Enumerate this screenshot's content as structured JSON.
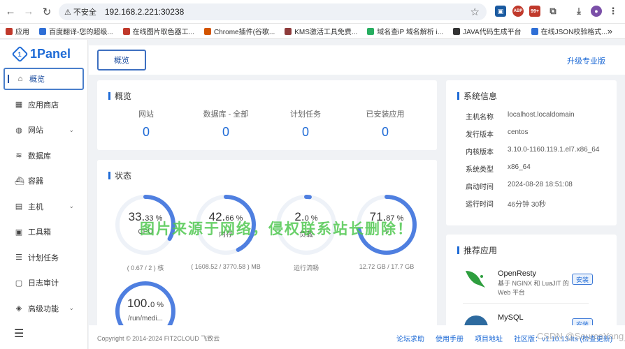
{
  "browser": {
    "url": "192.168.2.221:30238",
    "security_label": "不安全",
    "bookmarks": [
      {
        "label": "应用",
        "color": "#c0392b"
      },
      {
        "label": "百度翻译-您的超级...",
        "color": "#2f6fd6"
      },
      {
        "label": "在线图片取色器工...",
        "color": "#c0392b"
      },
      {
        "label": "Chrome插件(谷歌...",
        "color": "#d35400"
      },
      {
        "label": "KMS激活工具免费...",
        "color": "#8e3b3b"
      },
      {
        "label": "域名查iP 域名解析 i...",
        "color": "#27ae60"
      },
      {
        "label": "JAVA代码生成平台",
        "color": "#333333"
      },
      {
        "label": "在线JSON校验格式...",
        "color": "#2f6fd6"
      }
    ],
    "ext_badges": {
      "abp": "ABP",
      "count": "99+"
    }
  },
  "sidebar": {
    "brand": "1Panel",
    "items": [
      {
        "label": "概览",
        "icon": "home-icon",
        "glyph": "⌂",
        "active": true,
        "chevron": false
      },
      {
        "label": "应用商店",
        "icon": "grid-icon",
        "glyph": "▦",
        "chevron": false
      },
      {
        "label": "网站",
        "icon": "globe-icon",
        "glyph": "◍",
        "chevron": true
      },
      {
        "label": "数据库",
        "icon": "layers-icon",
        "glyph": "≋",
        "chevron": false
      },
      {
        "label": "容器",
        "icon": "docker-icon",
        "glyph": "⛴",
        "chevron": false
      },
      {
        "label": "主机",
        "icon": "host-icon",
        "glyph": "▤",
        "chevron": true
      },
      {
        "label": "工具箱",
        "icon": "toolbox-icon",
        "glyph": "▣",
        "chevron": false
      },
      {
        "label": "计划任务",
        "icon": "task-icon",
        "glyph": "☰",
        "chevron": false
      },
      {
        "label": "日志审计",
        "icon": "log-icon",
        "glyph": "▢",
        "chevron": false
      },
      {
        "label": "高级功能",
        "icon": "diamond-icon",
        "glyph": "◈",
        "chevron": true
      }
    ]
  },
  "header": {
    "tab": "概览",
    "upgrade": "升级专业版"
  },
  "overview": {
    "title": "概览",
    "stats": [
      {
        "label": "网站",
        "value": "0"
      },
      {
        "label": "数据库 - 全部",
        "value": "0"
      },
      {
        "label": "计划任务",
        "value": "0"
      },
      {
        "label": "已安装应用",
        "value": "0"
      }
    ]
  },
  "status": {
    "title": "状态",
    "gauges": [
      {
        "int": "33.",
        "dec": "33",
        "unit": " %",
        "label": "CPU",
        "percent": 33.33,
        "sub": "( 0.67 / 2 ) 核"
      },
      {
        "int": "42.",
        "dec": "66",
        "unit": " %",
        "label": "内存",
        "percent": 42.66,
        "sub": "( 1608.52 / 3770.58 ) MB"
      },
      {
        "int": "2.",
        "dec": "0",
        "unit": " %",
        "label": "负载",
        "percent": 2.0,
        "sub": "运行流畅"
      },
      {
        "int": "71.",
        "dec": "87",
        "unit": " %",
        "label": "/",
        "percent": 71.87,
        "sub": "12.72 GB / 17.7 GB"
      },
      {
        "int": "100.",
        "dec": "0",
        "unit": " %",
        "label": "/run/medi...",
        "percent": 100.0,
        "sub": ""
      }
    ]
  },
  "sysinfo": {
    "title": "系统信息",
    "rows": [
      {
        "k": "主机名称",
        "v": "localhost.localdomain"
      },
      {
        "k": "发行版本",
        "v": "centos"
      },
      {
        "k": "内核版本",
        "v": "3.10.0-1160.119.1.el7.x86_64"
      },
      {
        "k": "系统类型",
        "v": "x86_64"
      },
      {
        "k": "启动时间",
        "v": "2024-08-28 18:51:08"
      },
      {
        "k": "运行时间",
        "v": "46分钟 30秒"
      }
    ]
  },
  "recommend": {
    "title": "推荐应用",
    "apps": [
      {
        "name": "OpenResty",
        "desc1": "基于 NGINX 和 LuaJIT 的",
        "desc2": "Web 平台",
        "btn": "安装"
      },
      {
        "name": "MySQL",
        "desc1": "",
        "desc2": "",
        "btn": "安装"
      }
    ]
  },
  "footer": {
    "copyright": "Copyright © 2014-2024 FIT2CLOUD 飞致云",
    "links": [
      "论坛求助",
      "使用手册",
      "项目地址",
      "社区版：v1.10.13-lts (检查更新)"
    ]
  },
  "watermark": "图片来源于网络，侵权联系站长删除！",
  "csdn_mark": "CSDN @SourceYang_A"
}
